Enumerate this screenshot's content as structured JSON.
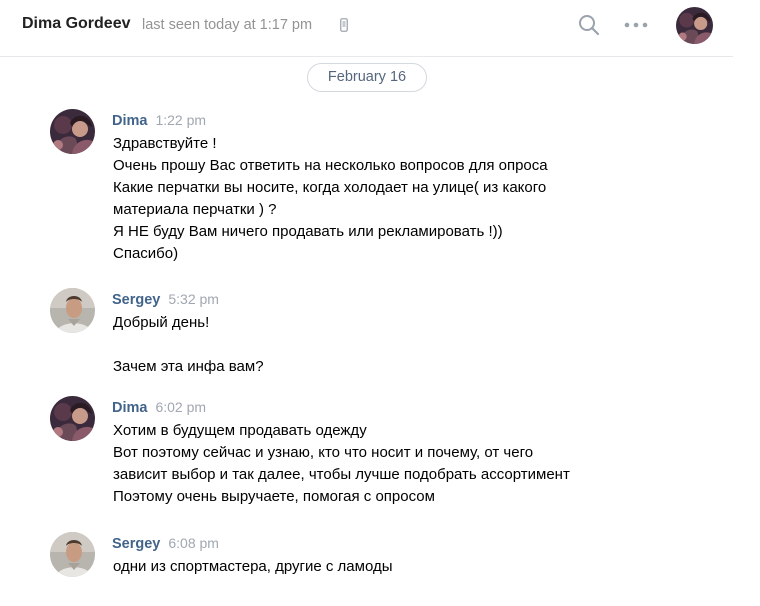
{
  "header": {
    "contact_name": "Dima Gordeev",
    "status": "last seen today at 1:17 pm",
    "status_icon": "mobile-phone-icon",
    "search_icon": "search-icon",
    "more_icon": "more-dots-icon"
  },
  "date_separator": "February 16",
  "messages": [
    {
      "author": "Dima",
      "time": "1:22 pm",
      "lines": [
        "Здравствуйте !",
        "Очень прошу Вас ответить на несколько вопросов для опроса",
        "Какие перчатки вы носите, когда холодает на улице( из какого",
        "материала перчатки ) ?",
        "Я НЕ буду Вам ничего продавать или рекламировать !))",
        "Спасибо)"
      ]
    },
    {
      "author": "Sergey",
      "time": "5:32 pm",
      "lines": [
        "Добрый день!",
        "",
        "Зачем эта инфа вам?"
      ]
    },
    {
      "author": "Dima",
      "time": "6:02 pm",
      "lines": [
        "Хотим в будущем продавать одежду",
        "Вот поэтому сейчас и узнаю, кто что носит и почему, от чего",
        "зависит выбор и так далее, чтобы лучше подобрать ассортимент",
        "Поэтому очень выручаете, помогая с опросом"
      ]
    },
    {
      "author": "Sergey",
      "time": "6:08 pm",
      "lines": [
        "одни из спортмастера, другие с ламоды"
      ]
    }
  ],
  "colors": {
    "author": "#42648b",
    "timestamp": "#a0a7b0",
    "status": "#939393"
  }
}
